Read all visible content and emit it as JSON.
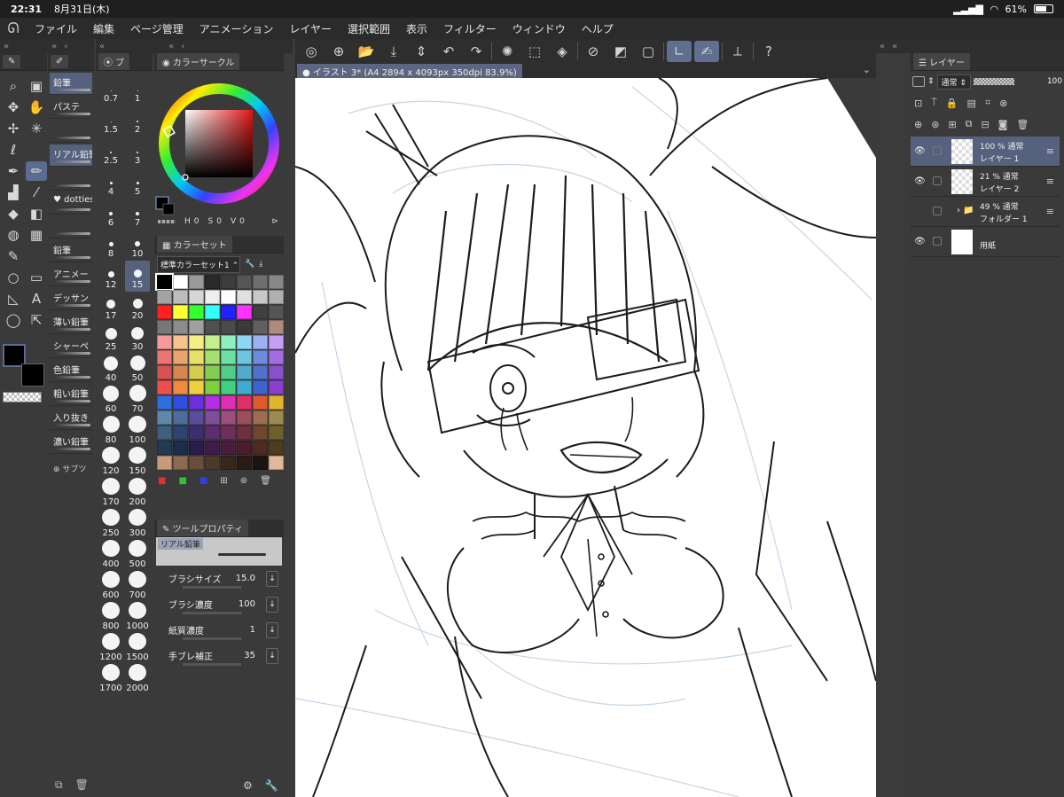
{
  "status": {
    "time": "22:31",
    "date": "8月31日(木)",
    "battery": "61%"
  },
  "menu": [
    "ファイル",
    "編集",
    "ページ管理",
    "アニメーション",
    "レイヤー",
    "選択範囲",
    "表示",
    "フィルター",
    "ウィンドウ",
    "ヘルプ"
  ],
  "strip": {
    "collapse": "«",
    "back": "‹"
  },
  "tools": {
    "icons": [
      "zoom-icon",
      "gradient-icon",
      "move-layer-icon",
      "hand-icon",
      "move-icon",
      "auto-select-icon",
      "lasso-icon",
      "blank-icon",
      "pen-icon",
      "pencil-icon",
      "fill-icon",
      "eyedropper-icon",
      "bucket-icon",
      "eraser-icon",
      "blend-icon",
      "pattern-icon",
      "brush-icon",
      "blank2-icon",
      "ellipse-icon",
      "frame-icon",
      "ruler-icon",
      "text-icon",
      "balloon-icon",
      "operation-icon"
    ],
    "glyphs": [
      "⌕",
      "▣",
      "✥",
      "✋",
      "✢",
      "✳",
      "ℓ",
      "",
      "✒",
      "✏",
      "▟",
      "⁄",
      "◆",
      "◧",
      "◍",
      "▦",
      "✎",
      "",
      "○",
      "▭",
      "◺",
      "A",
      "◯",
      "⇱"
    ],
    "selected": 9
  },
  "subtools": {
    "header_tab": "",
    "items": [
      {
        "label": "鉛筆",
        "sel": true
      },
      {
        "label": "パステ",
        "sel": false
      },
      {
        "label": "",
        "sel": false
      },
      {
        "label": "リアル鉛筆",
        "sel": true
      },
      {
        "label": "",
        "sel": false
      },
      {
        "label": "♥ dotties",
        "sel": false
      },
      {
        "label": "",
        "sel": false
      },
      {
        "label": "鉛筆",
        "sel": false
      },
      {
        "label": "アニメー",
        "sel": false
      },
      {
        "label": "デッサン",
        "sel": false
      },
      {
        "label": "薄い鉛筆",
        "sel": false
      },
      {
        "label": "シャーペ",
        "sel": false
      },
      {
        "label": "色鉛筆",
        "sel": false
      },
      {
        "label": "粗い鉛筆",
        "sel": false
      },
      {
        "label": "入り抜き",
        "sel": false
      },
      {
        "label": "濃い鉛筆",
        "sel": false
      }
    ],
    "add_label": "サブツ"
  },
  "brush_sizes": {
    "tab": "ブ",
    "items": [
      {
        "label": "0.7",
        "d": 1
      },
      {
        "label": "1",
        "d": 1
      },
      {
        "label": "1.5",
        "d": 1
      },
      {
        "label": "2",
        "d": 2
      },
      {
        "label": "2.5",
        "d": 2
      },
      {
        "label": "3",
        "d": 2
      },
      {
        "label": "4",
        "d": 3
      },
      {
        "label": "5",
        "d": 3
      },
      {
        "label": "6",
        "d": 4
      },
      {
        "label": "7",
        "d": 4
      },
      {
        "label": "8",
        "d": 5
      },
      {
        "label": "10",
        "d": 6
      },
      {
        "label": "12",
        "d": 7
      },
      {
        "label": "15",
        "d": 9
      },
      {
        "label": "17",
        "d": 10
      },
      {
        "label": "20",
        "d": 11
      },
      {
        "label": "25",
        "d": 13
      },
      {
        "label": "30",
        "d": 14
      },
      {
        "label": "40",
        "d": 16
      },
      {
        "label": "50",
        "d": 17
      },
      {
        "label": "60",
        "d": 18
      },
      {
        "label": "70",
        "d": 19
      },
      {
        "label": "80",
        "d": 19
      },
      {
        "label": "100",
        "d": 20
      },
      {
        "label": "120",
        "d": 20
      },
      {
        "label": "150",
        "d": 20
      },
      {
        "label": "170",
        "d": 20
      },
      {
        "label": "200",
        "d": 20
      },
      {
        "label": "250",
        "d": 20
      },
      {
        "label": "300",
        "d": 20
      },
      {
        "label": "400",
        "d": 20
      },
      {
        "label": "500",
        "d": 20
      },
      {
        "label": "600",
        "d": 20
      },
      {
        "label": "700",
        "d": 20
      },
      {
        "label": "800",
        "d": 20
      },
      {
        "label": "1000",
        "d": 20
      },
      {
        "label": "1200",
        "d": 20
      },
      {
        "label": "1500",
        "d": 20
      },
      {
        "label": "1700",
        "d": 20
      },
      {
        "label": "2000",
        "d": 20
      }
    ],
    "selected": "15"
  },
  "color_circle": {
    "title": "カラーサークル",
    "h_label": "H",
    "h": "0",
    "s_label": "S",
    "s": "0",
    "v_label": "V",
    "v": "0"
  },
  "color_set": {
    "title": "カラーセット",
    "set_name": "標準カラーセット1",
    "swatches": [
      "#000000",
      "#ffffff",
      "#9a9a9a",
      "#2a2a2a",
      "#3d3d3d",
      "#555555",
      "#6e6e6e",
      "#888888",
      "#a3a3a3",
      "#bdbdbd",
      "#d6d6d6",
      "#eeeeee",
      "#ffffff",
      "#e0e0e0",
      "#c8c8c8",
      "#b0b0b0",
      "#ff2020",
      "#ffff33",
      "#33ff33",
      "#33ffff",
      "#2222ff",
      "#ff33ff",
      "#404040",
      "#555555",
      "#777777",
      "#8c8c8c",
      "#a0a0a0",
      "#505050",
      "#4a4a4a",
      "#3a3a3a",
      "#606060",
      "#b08a7a",
      "#f49a9a",
      "#f5c48f",
      "#f7ee88",
      "#c4f08a",
      "#8ef0c0",
      "#8ed8f5",
      "#9fb0f5",
      "#c49ff5",
      "#e97575",
      "#e9a56d",
      "#e9e06c",
      "#a4e06c",
      "#6ce0a4",
      "#6cc4e0",
      "#6c8ce0",
      "#a46ce0",
      "#d65353",
      "#d68652",
      "#d6cc52",
      "#86cc52",
      "#52cc86",
      "#52aacc",
      "#5270cc",
      "#8652cc",
      "#ee4f4f",
      "#ef8a3f",
      "#efcf3f",
      "#7fcf3f",
      "#3fcf7f",
      "#3fa9cf",
      "#3f64cf",
      "#8a3fcf",
      "#2f6ee0",
      "#2f4de0",
      "#6b2fe0",
      "#b42fe0",
      "#e02fb4",
      "#e02f6b",
      "#e05a2f",
      "#e0b42f",
      "#5f88ad",
      "#4e6d9c",
      "#5a4e9c",
      "#7e4e9c",
      "#9c4e7e",
      "#9c4e5a",
      "#9c6d4e",
      "#9c8a4e",
      "#3d5f80",
      "#2e4470",
      "#3e2e70",
      "#5c2e70",
      "#702e5c",
      "#702e3e",
      "#70462e",
      "#705f2e",
      "#223a54",
      "#1c2c4c",
      "#2a1c4c",
      "#3e1c4c",
      "#4c1c3e",
      "#4c1c2a",
      "#4c2c1c",
      "#4c3e1c",
      "#c79a7a",
      "#8c6a52",
      "#6a4e3c",
      "#4e3828",
      "#38281c",
      "#281c14",
      "#1c140e",
      "#e0b89a"
    ]
  },
  "tool_property": {
    "title": "ツールプロパティ",
    "tool_name": "リアル鉛筆",
    "rows": [
      {
        "label": "ブラシサイズ",
        "value": "15.0"
      },
      {
        "label": "ブラシ濃度",
        "value": "100"
      },
      {
        "label": "紙質濃度",
        "value": "1"
      },
      {
        "label": "手ブレ補正",
        "value": "35"
      }
    ]
  },
  "toolbar_icons": [
    "spiral-icon",
    "new-icon",
    "open-icon",
    "save-icon",
    "updown-icon",
    "undo-icon",
    "redo-icon",
    "sep",
    "loading-icon",
    "transform-icon",
    "fill-icon",
    "sep",
    "clear-icon",
    "hatch-icon",
    "frame-icon",
    "sep",
    "stroke-icon",
    "sel",
    "brush-icon",
    "sep",
    "ruler-icon",
    "sep",
    "help-icon"
  ],
  "document": {
    "tab_label": "イラスト 3* (A4 2894 x 4093px 350dpi 83.9%)"
  },
  "layers": {
    "title": "レイヤー",
    "blend_mode": "通常",
    "opacity": "100",
    "rows": [
      {
        "opacity": "100 % 通常",
        "name": "レイヤー 1",
        "type": "layer",
        "visible": true,
        "selected": true
      },
      {
        "opacity": "21 % 通常",
        "name": "レイヤー 2",
        "type": "layer",
        "visible": true,
        "selected": false
      },
      {
        "opacity": "49 % 通常",
        "name": "フォルダー 1",
        "type": "folder",
        "visible": false,
        "selected": false
      },
      {
        "opacity": "",
        "name": "用紙",
        "type": "paper",
        "visible": true,
        "selected": false
      }
    ]
  }
}
